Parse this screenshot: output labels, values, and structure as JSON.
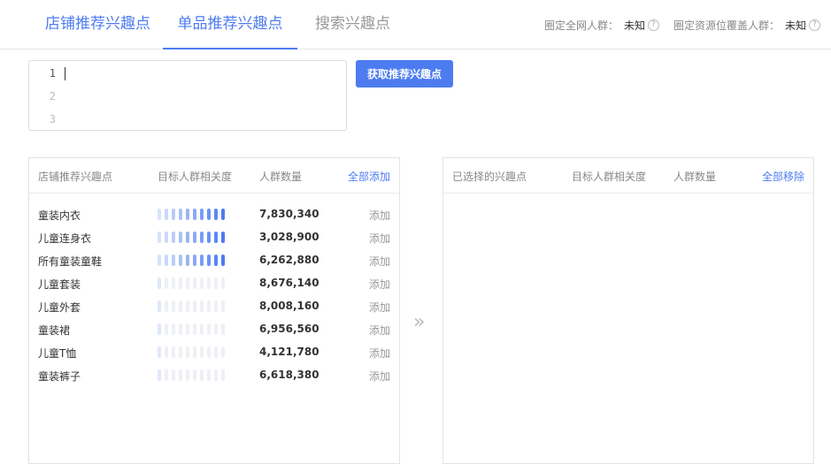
{
  "tabs": [
    {
      "label": "店铺推荐兴趣点"
    },
    {
      "label": "单品推荐兴趣点"
    },
    {
      "label": "搜索兴趣点"
    }
  ],
  "stats": {
    "fixed_network": {
      "label": "圈定全网人群：",
      "value": "未知"
    },
    "fixed_resource": {
      "label": "圈定资源位覆盖人群：",
      "value": "未知"
    }
  },
  "editor": {
    "lines": [
      "1",
      "2",
      "3"
    ]
  },
  "fetch_button": "获取推荐兴趣点",
  "left_panel": {
    "headers": {
      "name": "店铺推荐兴趣点",
      "relevance": "目标人群相关度",
      "count": "人群数量",
      "action": "全部添加"
    },
    "rows": [
      {
        "name": "童装内衣",
        "relevance": 1.0,
        "count": "7,830,340",
        "action": "添加"
      },
      {
        "name": "儿童连身衣",
        "relevance": 1.0,
        "count": "3,028,900",
        "action": "添加"
      },
      {
        "name": "所有童装童鞋",
        "relevance": 1.0,
        "count": "6,262,880",
        "action": "添加"
      },
      {
        "name": "儿童套装",
        "relevance": 0.1,
        "count": "8,676,140",
        "action": "添加"
      },
      {
        "name": "儿童外套",
        "relevance": 0.1,
        "count": "8,008,160",
        "action": "添加"
      },
      {
        "name": "童装裙",
        "relevance": 0.1,
        "count": "6,956,560",
        "action": "添加"
      },
      {
        "name": "儿童T恤",
        "relevance": 0.1,
        "count": "4,121,780",
        "action": "添加"
      },
      {
        "name": "童装裤子",
        "relevance": 0.1,
        "count": "6,618,380",
        "action": "添加"
      }
    ]
  },
  "right_panel": {
    "headers": {
      "name": "已选择的兴趣点",
      "relevance": "目标人群相关度",
      "count": "人群数量",
      "action": "全部移除"
    }
  },
  "colors": {
    "accent": "#4d7cf0"
  }
}
